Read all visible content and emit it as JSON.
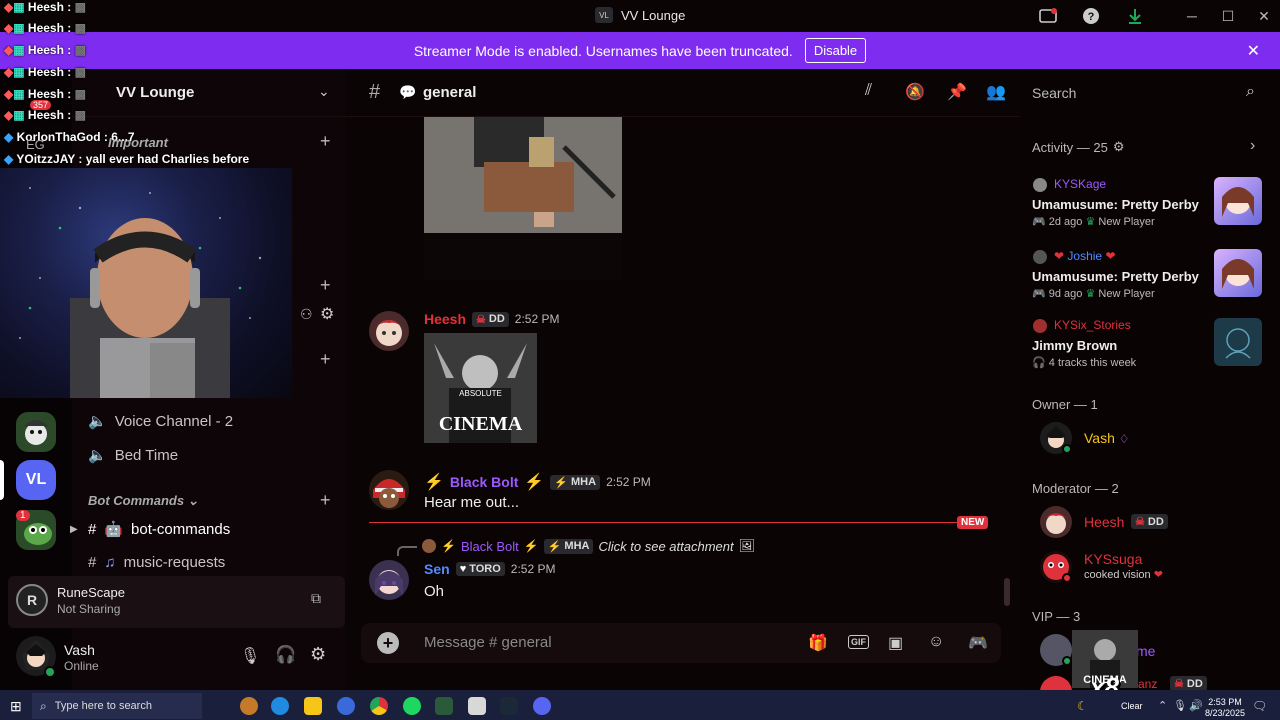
{
  "window": {
    "badge": "VL",
    "title": "VV Lounge"
  },
  "banner": {
    "text": "Streamer Mode is enabled. Usernames have been truncated.",
    "button": "Disable"
  },
  "overlay_chat": [
    {
      "name": "Heesh",
      "sep": ":"
    },
    {
      "name": "Heesh",
      "sep": ":"
    },
    {
      "name": "Heesh",
      "sep": ":"
    },
    {
      "name": "Heesh",
      "sep": ":"
    },
    {
      "name": "Heesh",
      "sep": ":"
    },
    {
      "name": "Heesh",
      "sep": ":"
    },
    {
      "name": "KorlonThaGod",
      "sep": ": 6...7"
    },
    {
      "name": "YOitzzJAY",
      "sep": ": yall ever had Charlies before"
    }
  ],
  "server": {
    "name": "VV Lounge",
    "badge_count": "357",
    "vl_icon": "VL",
    "notif": "1"
  },
  "channels": {
    "partial_initials": "EG",
    "important_category": "Important",
    "voice2": "Voice Channel - 2",
    "bedtime": "Bed Time",
    "bot_category": "Bot Commands",
    "bot_commands": "bot-commands",
    "music_requests": "music-requests"
  },
  "activity_card": {
    "game": "RuneScape",
    "status": "Not Sharing"
  },
  "user": {
    "name": "Vash",
    "status": "Online"
  },
  "chat": {
    "channel": "general",
    "messages": [
      {
        "author": "Heesh",
        "tag": "DD",
        "time": "2:52 PM",
        "image_text": "ABSOLUTE",
        "image_big": "CINEMA"
      },
      {
        "author": "Black Bolt",
        "tag": "MHA",
        "time": "2:52 PM",
        "text": "Hear me out..."
      },
      {
        "reply_author": "Black Bolt",
        "reply_tag": "MHA",
        "reply_text": "Click to see attachment",
        "author": "Sen",
        "tag": "TORO",
        "time": "2:52 PM",
        "text": "Oh"
      }
    ],
    "new_label": "NEW",
    "placeholder": "Message # general"
  },
  "members": {
    "search": "Search",
    "activity_header": "Activity — 25",
    "activity": [
      {
        "name": "KYSKage",
        "game": "Umamusume: Pretty Derby",
        "ago": "2d ago",
        "badge": "New Player"
      },
      {
        "name": "Joshie",
        "game": "Umamusume: Pretty Derby",
        "ago": "9d ago",
        "badge": "New Player"
      },
      {
        "name": "KYSix_Stories",
        "game": "Jimmy Brown",
        "ago": "4 tracks this week"
      }
    ],
    "owner_header": "Owner — 1",
    "owner": "Vash",
    "mod_header": "Moderator — 2",
    "mods": [
      {
        "name": "Heesh",
        "tag": "DD"
      },
      {
        "name": "KYSsuga",
        "status": "cooked vision"
      }
    ],
    "vip_header": "VIP — 3",
    "vip_partial": [
      "me",
      "anz"
    ],
    "vip_tag": "DD",
    "overlay_badge": "x8",
    "overlay_cinema": "CINEMA"
  },
  "taskbar": {
    "search": "Type here to search",
    "weather": "Clear",
    "time": "2:53 PM",
    "date": "8/23/2025"
  },
  "colors": {
    "accent": "#7e2cf0",
    "red_name": "#e0323c",
    "purple_name": "#9b59ff",
    "blue_name": "#4f8cff",
    "online": "#23a559"
  }
}
